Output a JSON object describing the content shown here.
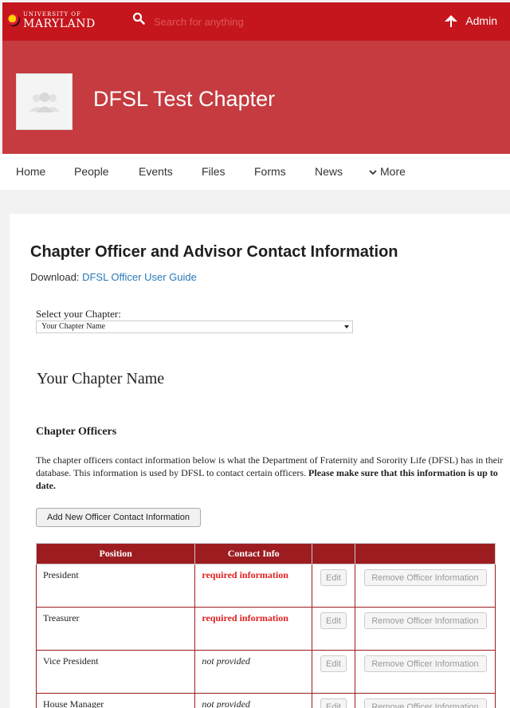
{
  "topbar": {
    "logo_small": "UNIVERSITY OF",
    "logo_big": "MARYLAND",
    "search_placeholder": "Search for anything",
    "admin_label": "Admin"
  },
  "banner": {
    "title": "DFSL Test Chapter"
  },
  "nav": {
    "items": [
      "Home",
      "People",
      "Events",
      "Files",
      "Forms",
      "News",
      "More"
    ]
  },
  "content": {
    "heading": "Chapter Officer and Advisor Contact Information",
    "download_label": "Download:",
    "download_link": "DFSL Officer User Guide",
    "select_label": "Select your Chapter:",
    "select_value": "Your Chapter Name",
    "chapter_heading": "Your Chapter Name",
    "officers_heading": "Chapter Officers",
    "paragraph": "The chapter officers contact information below is what the Department of Fraternity and Sorority Life (DFSL) has in their database. This information is used by DFSL to contact certain officers.",
    "paragraph_bold": "Please make sure that this information is up to date.",
    "add_button": "Add New Officer Contact Information",
    "table": {
      "headers": [
        "Position",
        "Contact Info",
        "",
        ""
      ],
      "rows": [
        {
          "position": "President",
          "contact": "required information",
          "status": "required"
        },
        {
          "position": "Treasurer",
          "contact": "required information",
          "status": "required"
        },
        {
          "position": "Vice President",
          "contact": "not provided",
          "status": "missing"
        },
        {
          "position": "House Manager",
          "contact": "not provided",
          "status": "missing"
        }
      ],
      "edit_label": "Edit",
      "remove_label": "Remove Officer Information"
    }
  },
  "colors": {
    "topbar": "#c4161c",
    "banner": "#c53b3f",
    "table_header": "#9d1c20",
    "link": "#2a7ab8",
    "required": "#e02020"
  }
}
